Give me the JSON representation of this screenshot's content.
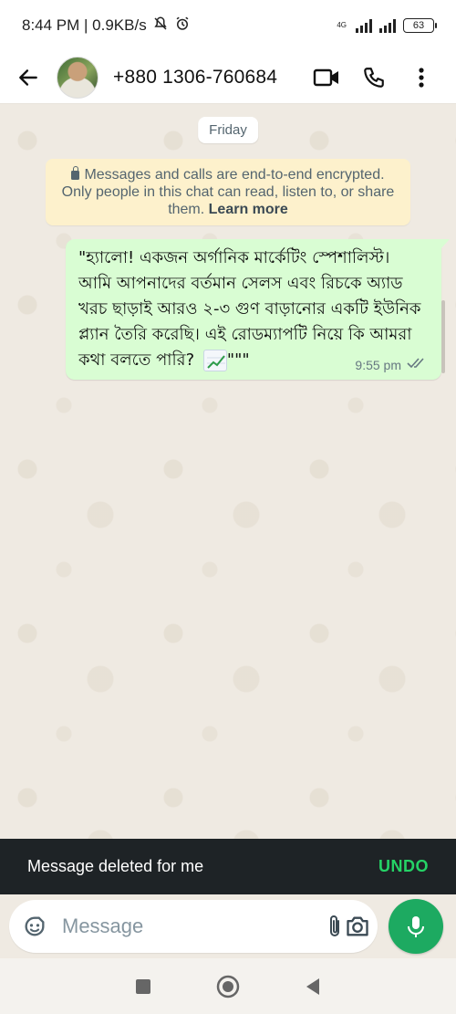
{
  "status_bar": {
    "time_speed": "8:44 PM | 0.9KB/s",
    "network_type": "4G",
    "battery": "63"
  },
  "header": {
    "contact_name": "+880 1306-760684",
    "icons": [
      "back-arrow-icon",
      "video-call-icon",
      "voice-call-icon",
      "more-options-icon"
    ]
  },
  "chat": {
    "date_chip": "Friday",
    "encryption_notice": "Messages and calls are end-to-end encrypted. Only people in this chat can read, listen to, or share them.",
    "learn_more": "Learn more",
    "message": {
      "text": "\"হ্যালো! একজন অর্গানিক মার্কেটিং স্পেশালিস্ট। আমি আপনাদের বর্তমান সেলস এবং রিচকে অ্যাড খরচ ছাড়াই আরও ২-৩ গুণ বাড়ানোর একটি ইউনিক প্ল্যান তৈরি করেছি। এই রোডম্যাপটি নিয়ে কি আমরা কথা বলতে পারি?",
      "trailing": "\"\"\"",
      "emoji": "chart-increasing-emoji",
      "time": "9:55 pm",
      "status": "read"
    }
  },
  "snackbar": {
    "text": "Message deleted for me",
    "action": "UNDO"
  },
  "composer": {
    "placeholder": "Message"
  },
  "colors": {
    "accent_green": "#25d366",
    "mic_green": "#1daa61",
    "bubble_out": "#d9fdd3",
    "chat_bg": "#efeae2",
    "notice_bg": "#fdf1cc"
  }
}
